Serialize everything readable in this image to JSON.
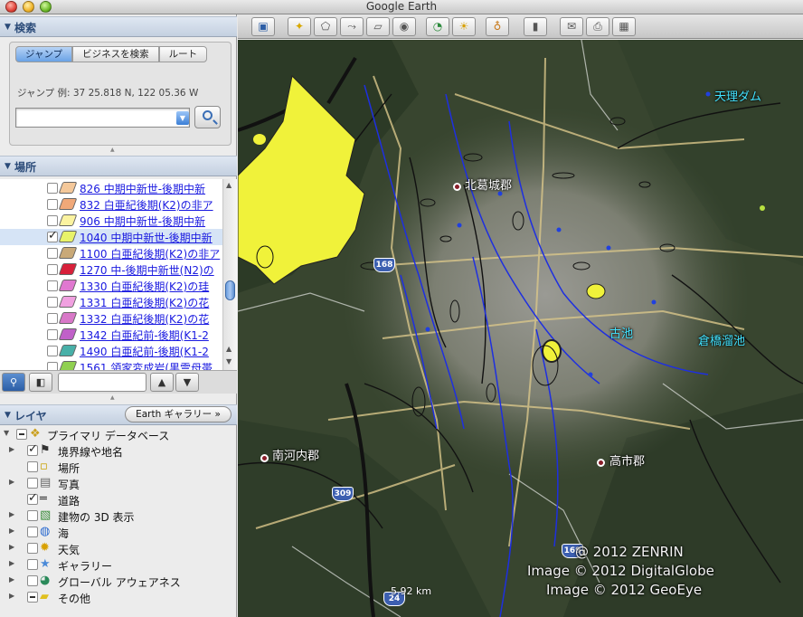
{
  "window": {
    "title": "Google Earth"
  },
  "search": {
    "header": "検索",
    "tabs": [
      "ジャンプ",
      "ビジネスを検索",
      "ルート"
    ],
    "hint": "ジャンプ 例: 37 25.818 N, 122 05.36 W",
    "input_value": ""
  },
  "places": {
    "header": "場所",
    "items": [
      {
        "label": "826 中期中新世-後期中新",
        "color": "#f4c89a",
        "checked": false
      },
      {
        "label": "832 白亜紀後期(K2)の非ア",
        "color": "#f0a878",
        "checked": false
      },
      {
        "label": "906 中期中新世-後期中新",
        "color": "#fbf3a0",
        "checked": false
      },
      {
        "label": "1040 中期中新世-後期中新",
        "color": "#e8f36a",
        "checked": true
      },
      {
        "label": "1100 白亜紀後期(K2)の非ア",
        "color": "#c9a978",
        "checked": false
      },
      {
        "label": "1270 中-後期中新世(N2)の",
        "color": "#d8203a",
        "checked": false
      },
      {
        "label": "1330 白亜紀後期(K2)の珪",
        "color": "#e078d0",
        "checked": false
      },
      {
        "label": "1331 白亜紀後期(K2)の花",
        "color": "#f0a0e0",
        "checked": false
      },
      {
        "label": "1332 白亜紀後期(K2)の花",
        "color": "#d878c8",
        "checked": false
      },
      {
        "label": "1342 白亜紀前-後期(K1-2",
        "color": "#c060c8",
        "checked": false
      },
      {
        "label": "1490 白亜紀前-後期(K1-2",
        "color": "#48b0a8",
        "checked": false
      },
      {
        "label": "1561 領家変成岩(黒雲母帯",
        "color": "#90d050",
        "checked": false
      }
    ]
  },
  "layers": {
    "header": "レイヤ",
    "gallery_button": "Earth ギャラリー »",
    "items": [
      {
        "label": "プライマリ データベース",
        "icon": "database-icon"
      },
      {
        "label": "境界線や地名",
        "icon": "flag-icon"
      },
      {
        "label": "場所",
        "icon": "place-icon"
      },
      {
        "label": "写真",
        "icon": "photo-icon"
      },
      {
        "label": "道路",
        "icon": "road-icon"
      },
      {
        "label": "建物の 3D 表示",
        "icon": "building-icon"
      },
      {
        "label": "海",
        "icon": "ocean-icon"
      },
      {
        "label": "天気",
        "icon": "weather-icon"
      },
      {
        "label": "ギャラリー",
        "icon": "gallery-star-icon"
      },
      {
        "label": "グローバル アウェアネス",
        "icon": "globe-icon"
      },
      {
        "label": "その他",
        "icon": "folder-icon"
      }
    ]
  },
  "map": {
    "labels": {
      "kitakatsuragi": "北葛城郡",
      "tenri_dam": "天理ダム",
      "furuike": "古池",
      "kurahashi": "倉橋溜池",
      "minamikawachi": "南河内郡",
      "takaichi": "高市郡"
    },
    "routes": {
      "r168": "168",
      "r309": "309",
      "r24": "24",
      "r169": "169"
    },
    "scale": "5.92 km",
    "credits": [
      "@ 2012 ZENRIN",
      "Image © 2012 DigitalGlobe",
      "Image © 2012 GeoEye"
    ]
  }
}
